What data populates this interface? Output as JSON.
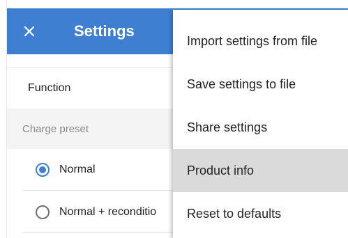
{
  "appbar": {
    "title": "Settings",
    "close_icon": "close-icon",
    "color": "#3f7fd1"
  },
  "settings": {
    "function_label": "Function",
    "charge_preset_header": "Charge preset",
    "options": [
      {
        "label": "Normal",
        "selected": true
      },
      {
        "label": "Normal + reconditio",
        "selected": false
      }
    ]
  },
  "menu": {
    "items": [
      {
        "label": "Import settings from file"
      },
      {
        "label": "Save settings to file"
      },
      {
        "label": "Share settings"
      },
      {
        "label": "Product info",
        "highlighted": true
      },
      {
        "label": "Reset to defaults"
      }
    ]
  }
}
